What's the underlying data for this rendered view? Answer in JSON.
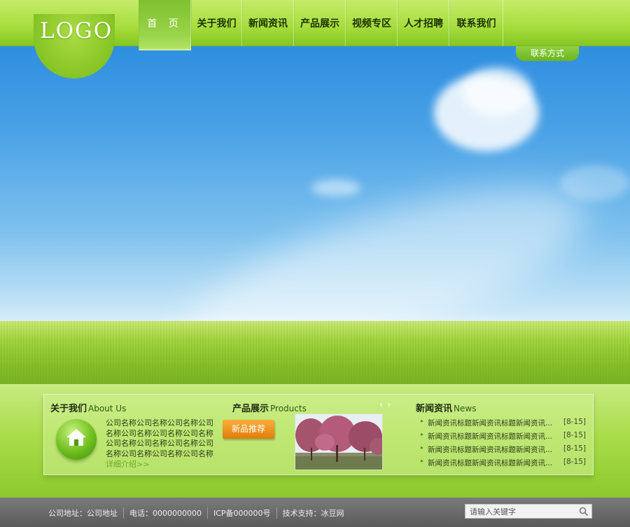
{
  "header": {
    "logo": "LOGO",
    "nav": [
      "首 页",
      "关于我们",
      "新闻资讯",
      "产品展示",
      "视频专区",
      "人才招聘",
      "联系我们"
    ],
    "contact_tab": "联系方式"
  },
  "banner": {
    "prev_icon": "chevron-left-icon",
    "next_icon": "chevron-right-icon"
  },
  "about": {
    "title": "关于我们",
    "title_en": "About Us",
    "text": "公司名称公司名称公司名称公司名称公司名称公司名称公司名称公司名称公司名称公司名称公司名称公司名称公司名称公司名称",
    "more": "详细介绍>>"
  },
  "products": {
    "title": "产品展示",
    "title_en": "Products",
    "button": "新品推荐",
    "prev": "‹",
    "next": "›"
  },
  "news": {
    "title": "新闻资讯",
    "title_en": "News",
    "items": [
      {
        "title": "新闻资讯标题新闻资讯标题新闻资讯...",
        "date": "[8-15]"
      },
      {
        "title": "新闻资讯标题新闻资讯标题新闻资讯...",
        "date": "[8-15]"
      },
      {
        "title": "新闻资讯标题新闻资讯标题新闻资讯...",
        "date": "[8-15]"
      },
      {
        "title": "新闻资讯标题新闻资讯标题新闻资讯...",
        "date": "[8-15]"
      }
    ]
  },
  "footer": {
    "address": "公司地址：公司地址",
    "phone": "电话：0000000000",
    "icp": "ICP备000000号",
    "support": "技术支持：冰豆网",
    "search_placeholder": "请输入关键字"
  },
  "colors": {
    "accent_green": "#86c623",
    "button_orange": "#f39a1e",
    "footer_gray": "#5a5a5a"
  }
}
